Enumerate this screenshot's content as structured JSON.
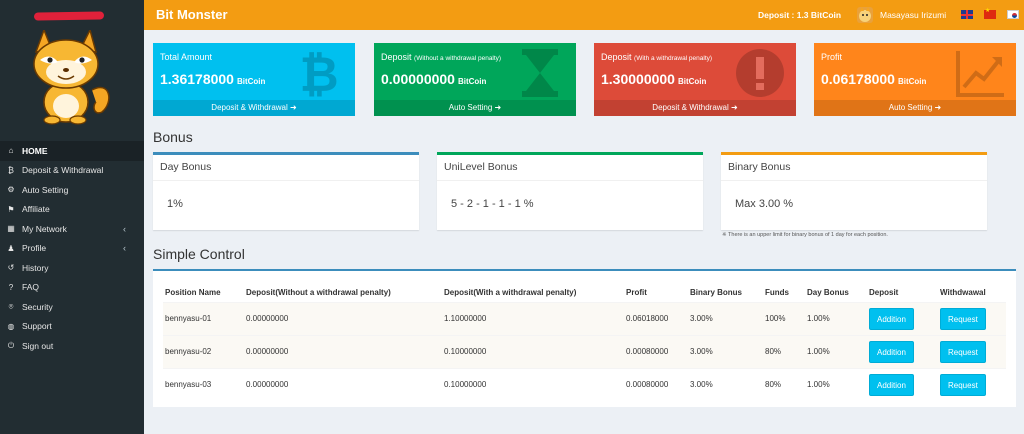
{
  "header": {
    "logo": "Bit Monster",
    "deposit": "Deposit : 1.3 BitCoin",
    "user_name": "Masayasu Irizumi"
  },
  "sidebar": {
    "items": [
      {
        "label": "HOME",
        "icon": "home-icon",
        "glyph": "⌂",
        "active": true
      },
      {
        "label": "Deposit & Withdrawal",
        "icon": "bitcoin-icon",
        "glyph": "₿"
      },
      {
        "label": "Auto Setting",
        "icon": "gear-icon",
        "glyph": "⚙"
      },
      {
        "label": "Affiliate",
        "icon": "flag-icon",
        "glyph": "⚑"
      },
      {
        "label": "My Network",
        "icon": "network-icon",
        "glyph": "▦",
        "chevron": "‹"
      },
      {
        "label": "Profile",
        "icon": "user-icon",
        "glyph": "♟",
        "chevron": "‹"
      },
      {
        "label": "History",
        "icon": "history-icon",
        "glyph": "↺"
      },
      {
        "label": "FAQ",
        "icon": "question-icon",
        "glyph": "?"
      },
      {
        "label": "Security",
        "icon": "lock-icon",
        "glyph": "⌾"
      },
      {
        "label": "Support",
        "icon": "globe-icon",
        "glyph": "◍"
      },
      {
        "label": "Sign out",
        "icon": "power-icon",
        "glyph": "⏻"
      }
    ]
  },
  "stats": [
    {
      "label": "Total Amount",
      "sub": "",
      "value": "1.36178000",
      "unit": "BitCoin",
      "footer": "Deposit & Withdrawal ➜",
      "color": "#00c0ef"
    },
    {
      "label": "Deposit",
      "sub": "(Without a withdrawal penalty)",
      "value": "0.00000000",
      "unit": "BitCoin",
      "footer": "Auto Setting ➜",
      "color": "#00a65a"
    },
    {
      "label": "Deposit",
      "sub": "(With a withdrawal penalty)",
      "value": "1.30000000",
      "unit": "BitCoin",
      "footer": "Deposit & Withdrawal ➜",
      "color": "#dd4b39"
    },
    {
      "label": "Profit",
      "sub": "",
      "value": "0.06178000",
      "unit": "BitCoin",
      "footer": "Auto Setting ➜",
      "color": "#ff851b"
    }
  ],
  "bonus": {
    "section_title": "Bonus",
    "boxes": [
      {
        "title": "Day Bonus",
        "value": "1%"
      },
      {
        "title": "UniLevel Bonus",
        "value": "5 - 2 - 1 - 1 - 1 %"
      },
      {
        "title": "Binary Bonus",
        "value": "Max 3.00 %"
      }
    ],
    "note": "※ There is an upper limit for binary bonus of 1 day for each position."
  },
  "control": {
    "section_title": "Simple Control",
    "columns": [
      "Position Name",
      "Deposit(Without a withdrawal penalty)",
      "Deposit(With a withdrawal penalty)",
      "Profit",
      "Binary Bonus",
      "Funds",
      "Day Bonus",
      "Deposit",
      "Withdwawal"
    ],
    "rows": [
      {
        "name": "bennyasu-01",
        "dep_no_penalty": "0.00000000",
        "dep_penalty": "1.10000000",
        "profit": "0.06018000",
        "binary": "3.00%",
        "funds": "100%",
        "day": "1.00%",
        "add": "Addition",
        "req": "Request"
      },
      {
        "name": "bennyasu-02",
        "dep_no_penalty": "0.00000000",
        "dep_penalty": "0.10000000",
        "profit": "0.00080000",
        "binary": "3.00%",
        "funds": "80%",
        "day": "1.00%",
        "add": "Addition",
        "req": "Request"
      },
      {
        "name": "bennyasu-03",
        "dep_no_penalty": "0.00000000",
        "dep_penalty": "0.10000000",
        "profit": "0.00080000",
        "binary": "3.00%",
        "funds": "80%",
        "day": "1.00%",
        "add": "Addition",
        "req": "Request"
      }
    ]
  },
  "colors": {
    "header": "#f39c12",
    "sidebar": "#222d32",
    "accent_blue": "#3c8dbc",
    "button": "#00c0ef"
  }
}
